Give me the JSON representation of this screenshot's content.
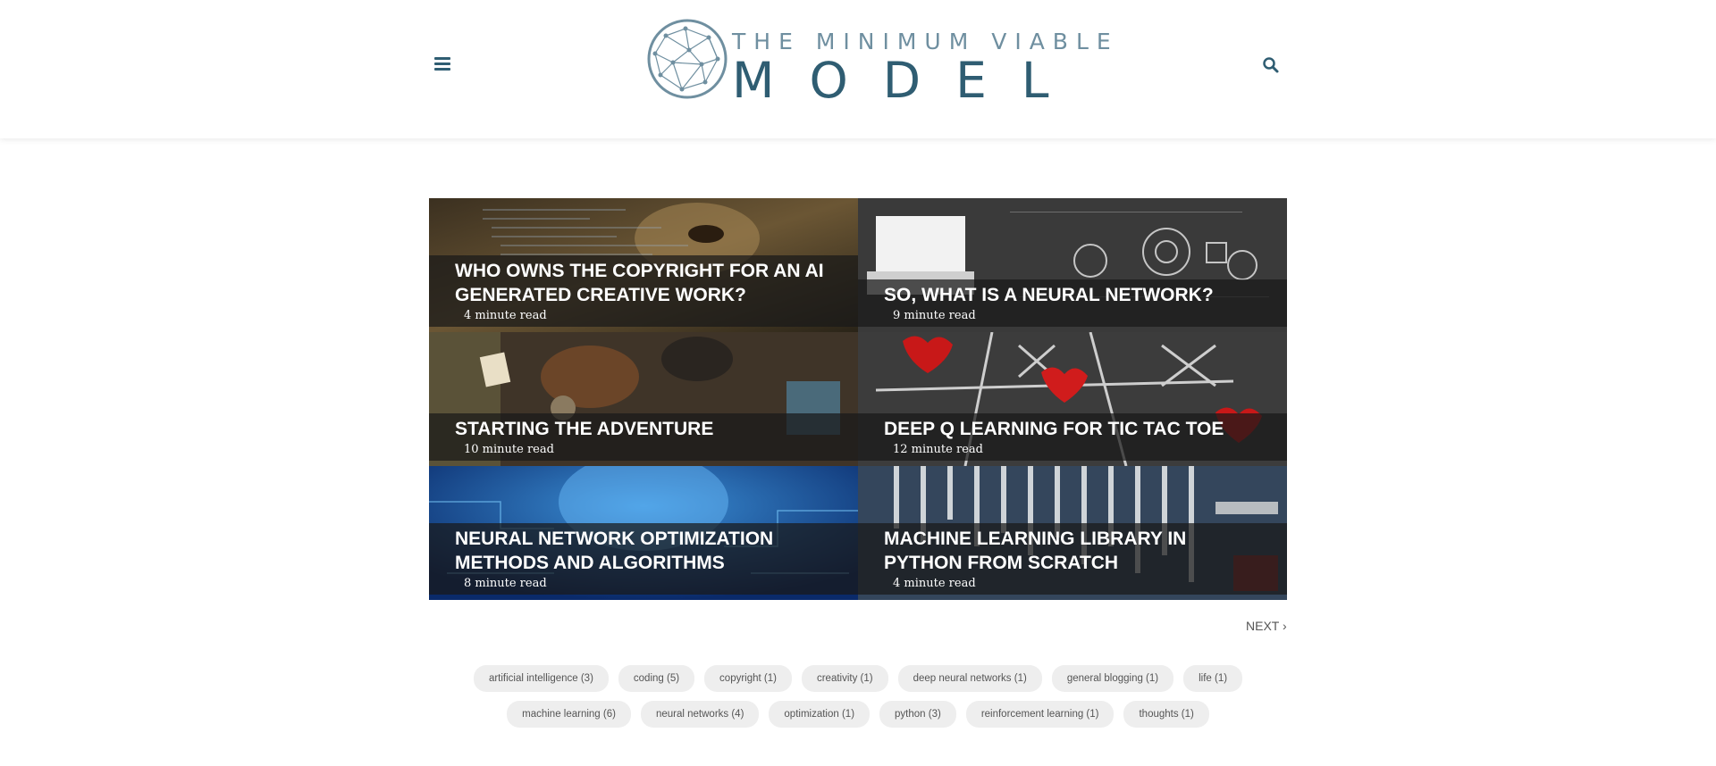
{
  "header": {
    "logo_top": "THE MINIMUM VIABLE",
    "logo_main": "MODEL",
    "menu_icon": "hamburger-menu-icon",
    "search_icon": "search-icon",
    "accent_color": "#2f5d72"
  },
  "posts": [
    {
      "title": "WHO OWNS THE COPYRIGHT FOR AN AI GENERATED CREATIVE WORK?",
      "read_time": "4 minute read",
      "image": "painting-eye-with-code"
    },
    {
      "title": "SO, WHAT IS A NEURAL NETWORK?",
      "read_time": "9 minute read",
      "image": "laptop-ai-icons-chalkboard"
    },
    {
      "title": "STARTING THE ADVENTURE",
      "read_time": "10 minute read",
      "image": "travel-gear-flatlay"
    },
    {
      "title": "DEEP Q LEARNING FOR TIC TAC TOE",
      "read_time": "12 minute read",
      "image": "tic-tac-toe-hearts-chalk"
    },
    {
      "title": "NEURAL NETWORK OPTIMIZATION METHODS AND ALGORITHMS",
      "read_time": "8 minute read",
      "image": "blue-digital-brain"
    },
    {
      "title": "MACHINE LEARNING LIBRARY IN PYTHON FROM SCRATCH",
      "read_time": "4 minute read",
      "image": "wrenches-tools"
    }
  ],
  "pagination": {
    "next_label": "NEXT ›"
  },
  "tags_row1": [
    "artificial intelligence (3)",
    "coding (5)",
    "copyright (1)",
    "creativity (1)",
    "deep neural networks (1)",
    "general blogging (1)",
    "life (1)"
  ],
  "tags_row2": [
    "machine learning (6)",
    "neural networks (4)",
    "optimization (1)",
    "python (3)",
    "reinforcement learning (1)",
    "thoughts (1)"
  ]
}
